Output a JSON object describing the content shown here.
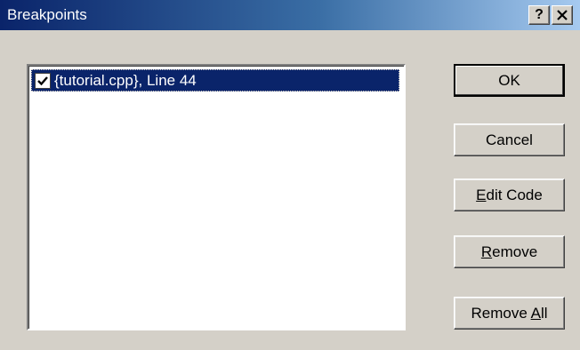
{
  "dialog": {
    "title": "Breakpoints",
    "help_label": "?",
    "close_label": "✕"
  },
  "breakpoints": [
    {
      "label": "{tutorial.cpp}, Line 44",
      "checked": true,
      "selected": true
    }
  ],
  "buttons": {
    "ok": "OK",
    "cancel": "Cancel",
    "edit_code": {
      "mnemonic": "E",
      "rest": "dit Code"
    },
    "remove": {
      "mnemonic": "R",
      "rest": "emove"
    },
    "remove_all": {
      "prefix": "Remove ",
      "mnemonic": "A",
      "rest": "ll"
    }
  },
  "colors": {
    "title_gradient_start": "#0a246a",
    "title_gradient_end": "#a6caf0",
    "selection": "#0a246a",
    "face": "#d4d0c8"
  }
}
